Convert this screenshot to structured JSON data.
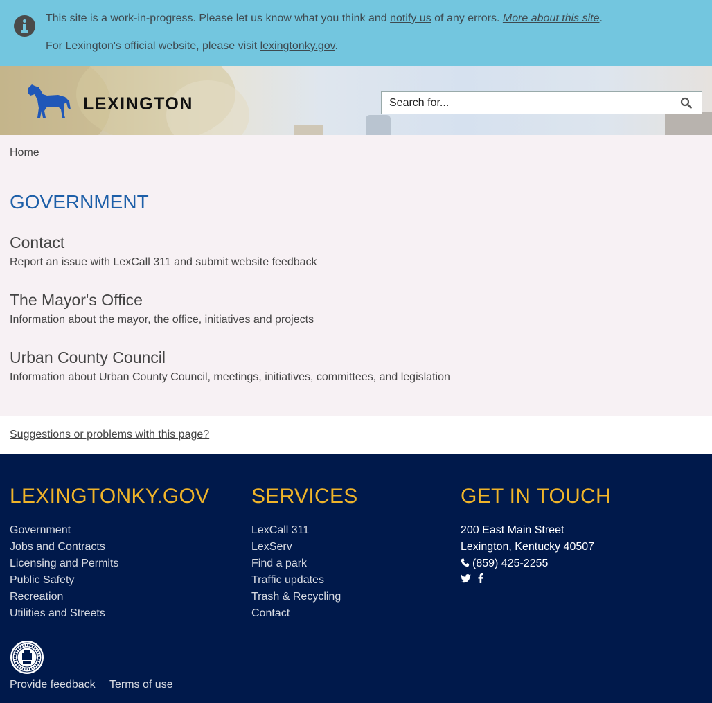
{
  "alert": {
    "line1_pre": "This site is a work-in-progress. Please let us know what you think and ",
    "notify_link": "notify us",
    "line1_mid": " of any errors. ",
    "more_link": "More about this site",
    "line1_end": ".",
    "line2_pre": "For Lexington's official website, please visit ",
    "official_link": "lexingtonky.gov",
    "line2_end": "."
  },
  "header": {
    "logo_text": "LEXINGTON",
    "search_placeholder": "Search for..."
  },
  "breadcrumb": {
    "home": "Home"
  },
  "page": {
    "title": "GOVERNMENT",
    "items": [
      {
        "title": "Contact",
        "description": "Report an issue with LexCall 311 and submit website feedback"
      },
      {
        "title": "The Mayor's Office",
        "description": "Information about the mayor, the office, initiatives and projects"
      },
      {
        "title": "Urban County Council",
        "description": "Information about Urban County Council, meetings, initiatives, committees, and legislation"
      }
    ]
  },
  "suggest": {
    "label": "Suggestions or problems with this page?"
  },
  "footer": {
    "col1": {
      "heading": "LEXINGTONKY.GOV",
      "links": [
        "Government",
        "Jobs and Contracts",
        "Licensing and Permits",
        "Public Safety",
        "Recreation",
        "Utilities and Streets"
      ]
    },
    "col2": {
      "heading": "SERVICES",
      "links": [
        "LexCall 311",
        "LexServ",
        "Find a park",
        "Traffic updates",
        "Trash & Recycling",
        "Contact"
      ]
    },
    "col3": {
      "heading": "GET IN TOUCH",
      "address1": "200 East Main Street",
      "address2": "Lexington, Kentucky 40507",
      "phone": "(859) 425-2255"
    },
    "provide_feedback": "Provide feedback",
    "terms": "Terms of use"
  },
  "colors": {
    "alert_bg": "#73c6df",
    "title_blue": "#1d5fa8",
    "footer_bg": "#00194b",
    "footer_heading": "#f0b429",
    "horse_blue": "#1f57b8"
  },
  "icons": [
    "info-icon",
    "horse-logo-icon",
    "search-icon",
    "phone-icon",
    "twitter-icon",
    "facebook-icon",
    "city-seal-icon"
  ]
}
